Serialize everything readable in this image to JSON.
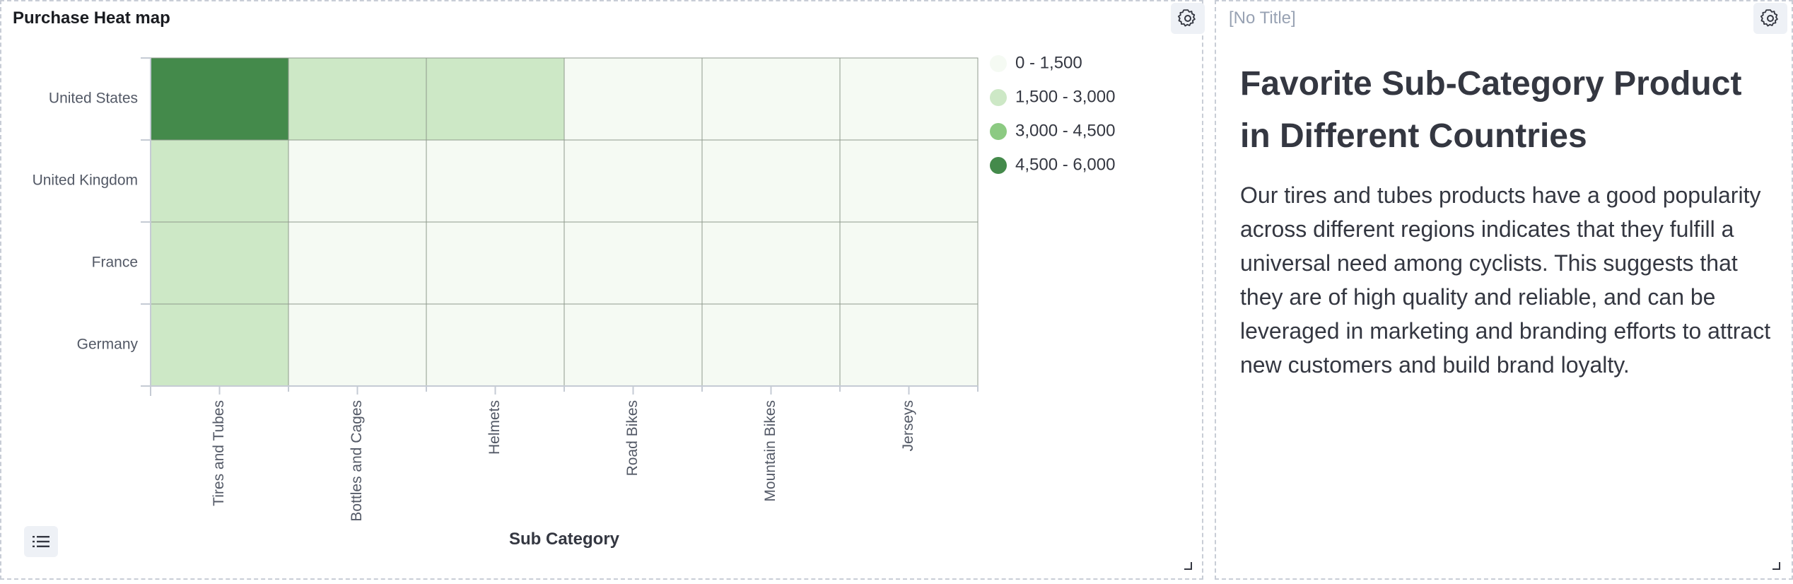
{
  "heatmap_panel": {
    "title": "Purchase Heat map",
    "settings_icon": "gear-icon",
    "legend_toggle_icon": "list-icon"
  },
  "markdown_panel": {
    "title": "[No Title]",
    "settings_icon": "gear-icon",
    "heading": "Favorite Sub-Category Product in Different Countries",
    "body": "Our tires and tubes products have a good popularity across different regions indicates that they fulfill a universal need among cyclists. This suggests that they are of high quality and reliable, and can be leveraged in marketing and branding efforts to attract new customers and build brand loyalty."
  },
  "colors": {
    "bin_0": "#f5faf3",
    "bin_1": "#cde8c6",
    "bin_2": "#8cca82",
    "bin_3": "#448a4b",
    "grid": "#8f9a8c",
    "panel_border": "#c8cdd6"
  },
  "chart_data": {
    "type": "heatmap",
    "title": "Purchase Heat map",
    "xlabel": "Sub Category",
    "ylabel": "",
    "x_categories": [
      "Tires and Tubes",
      "Bottles and Cages",
      "Helmets",
      "Road Bikes",
      "Mountain Bikes",
      "Jerseys"
    ],
    "y_categories": [
      "United States",
      "United Kingdom",
      "France",
      "Germany"
    ],
    "bins": [
      {
        "label": "0 - 1,500",
        "min": 0,
        "max": 1500
      },
      {
        "label": "1,500 - 3,000",
        "min": 1500,
        "max": 3000
      },
      {
        "label": "3,000 - 4,500",
        "min": 3000,
        "max": 4500
      },
      {
        "label": "4,500 - 6,000",
        "min": 4500,
        "max": 6000
      }
    ],
    "cell_bins": [
      [
        3,
        1,
        1,
        0,
        0,
        0
      ],
      [
        1,
        0,
        0,
        0,
        0,
        0
      ],
      [
        1,
        0,
        0,
        0,
        0,
        0
      ],
      [
        1,
        0,
        0,
        0,
        0,
        0
      ]
    ],
    "legend_position": "right",
    "grid": true
  }
}
